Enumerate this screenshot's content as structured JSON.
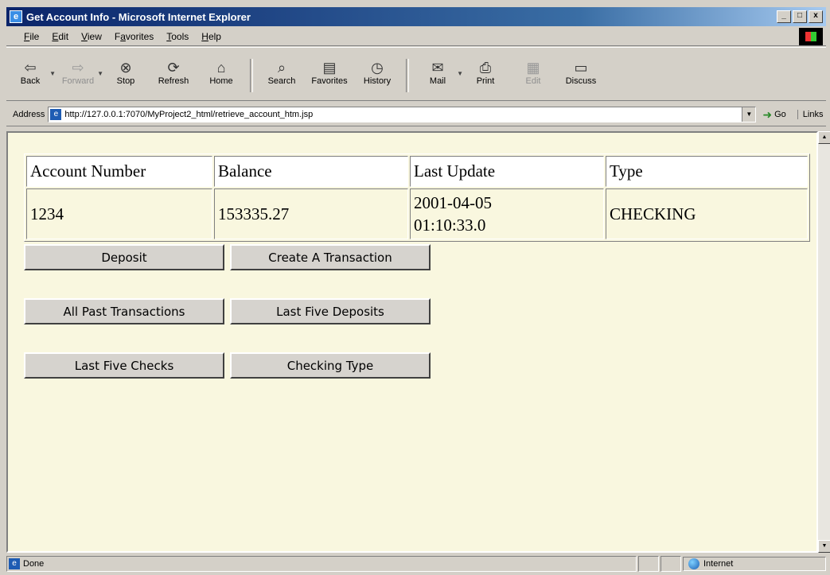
{
  "window": {
    "title": "Get Account Info - Microsoft Internet Explorer",
    "controls": [
      "_",
      "□",
      "x"
    ]
  },
  "menu": [
    {
      "key": "F",
      "rest": "ile"
    },
    {
      "key": "E",
      "rest": "dit"
    },
    {
      "key": "V",
      "rest": "iew"
    },
    {
      "pre": "F",
      "key": "a",
      "rest": "vorites"
    },
    {
      "key": "T",
      "rest": "ools"
    },
    {
      "key": "H",
      "rest": "elp"
    }
  ],
  "toolbar": {
    "back": "Back",
    "forward": "Forward",
    "stop": "Stop",
    "refresh": "Refresh",
    "home": "Home",
    "search": "Search",
    "favorites": "Favorites",
    "history": "History",
    "mail": "Mail",
    "print": "Print",
    "edit": "Edit",
    "discuss": "Discuss"
  },
  "address": {
    "label": "Address",
    "url": "http://127.0.0.1:7070/MyProject2_html/retrieve_account_htm.jsp",
    "go": "Go",
    "links": "Links"
  },
  "account_table": {
    "headers": [
      "Account Number",
      "Balance",
      "Last Update",
      "Type"
    ],
    "row": {
      "account_number": "1234",
      "balance": "153335.27",
      "last_update_date": "2001-04-05",
      "last_update_time": "01:10:33.0",
      "type": "CHECKING"
    }
  },
  "buttons": {
    "deposit": "Deposit",
    "create_transaction": "Create A Transaction",
    "all_past_transactions": "All Past Transactions",
    "last_five_deposits": "Last Five Deposits",
    "last_five_checks": "Last Five Checks",
    "checking_type": "Checking Type"
  },
  "status": {
    "text": "Done",
    "zone": "Internet"
  }
}
